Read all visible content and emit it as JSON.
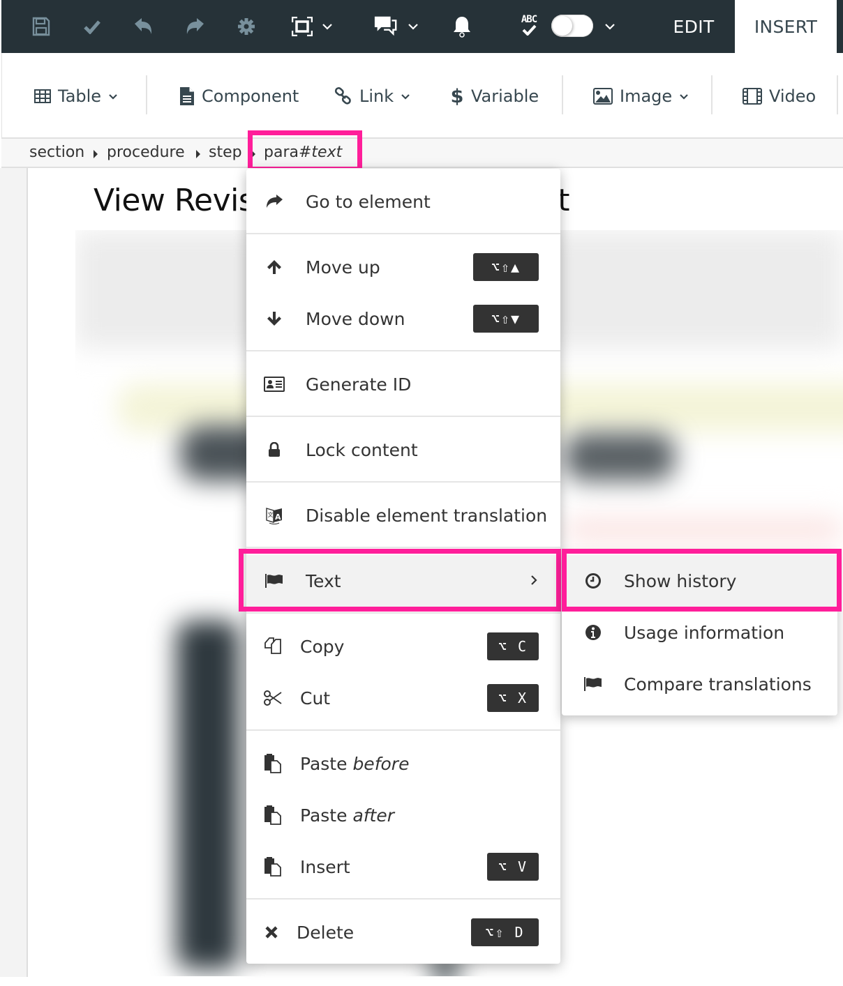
{
  "toolbar": {
    "icons": [
      "save-icon",
      "check-icon",
      "undo-icon",
      "redo-icon",
      "settings-icon",
      "fullscreen-icon",
      "comments-icon",
      "notifications-icon",
      "spellcheck-icon"
    ],
    "spellcheck_label": "ABC",
    "spellcheck_enabled": false,
    "modes": [
      {
        "label": "EDIT",
        "active": false
      },
      {
        "label": "INSERT",
        "active": true
      }
    ]
  },
  "ribbon": {
    "items": [
      {
        "label": "Table",
        "icon": "table-icon",
        "dropdown": true
      },
      {
        "label": "Component",
        "icon": "file-icon",
        "dropdown": false
      },
      {
        "label": "Link",
        "icon": "link-icon",
        "dropdown": true
      },
      {
        "label": "Variable",
        "icon": "dollar-icon",
        "dropdown": false
      },
      {
        "label": "Image",
        "icon": "image-icon",
        "dropdown": true
      },
      {
        "label": "Video",
        "icon": "film-icon",
        "dropdown": false
      }
    ]
  },
  "breadcrumb": {
    "items": [
      "section",
      "procedure",
      "step"
    ],
    "selected": {
      "element": "para",
      "separator": "#",
      "type": "text"
    }
  },
  "document": {
    "title_visible_start": "View Revis",
    "title_visible_end": "ent"
  },
  "context_menu": {
    "items": [
      {
        "label": "Go to element",
        "icon": "share-arrow-icon",
        "shortcut": null
      },
      {
        "label": "Move up",
        "icon": "arrow-up-icon",
        "shortcut": "⌥⇧▲"
      },
      {
        "label": "Move down",
        "icon": "arrow-down-icon",
        "shortcut": "⌥⇧▼"
      },
      {
        "label": "Generate ID",
        "icon": "id-card-icon",
        "shortcut": null
      },
      {
        "label": "Lock content",
        "icon": "lock-icon",
        "shortcut": null
      },
      {
        "label": "Disable element translation",
        "icon": "translate-icon",
        "shortcut": null
      },
      {
        "label": "Text",
        "icon": "flag-icon",
        "shortcut": null,
        "submenu": true,
        "active": true
      },
      {
        "label": "Copy",
        "icon": "copy-icon",
        "shortcut": "⌥ C"
      },
      {
        "label": "Cut",
        "icon": "scissors-icon",
        "shortcut": "⌥ X"
      },
      {
        "label": "Paste",
        "label_em": "before",
        "icon": "paste-icon",
        "shortcut": null
      },
      {
        "label": "Paste",
        "label_em": "after",
        "icon": "paste-icon",
        "shortcut": null
      },
      {
        "label": "Insert",
        "icon": "paste-icon",
        "shortcut": "⌥ V"
      },
      {
        "label": "Delete",
        "icon": "close-icon",
        "shortcut": "⌥⇧ D"
      }
    ]
  },
  "submenu": {
    "items": [
      {
        "label": "Show history",
        "icon": "clock-icon",
        "active": true
      },
      {
        "label": "Usage information",
        "icon": "info-icon",
        "active": false
      },
      {
        "label": "Compare translations",
        "icon": "flag-icon",
        "active": false
      }
    ]
  },
  "colors": {
    "toolbar_bg": "#263238",
    "toolbar_icon_muted": "#78909c",
    "annotation_highlight": "#ff1e9a",
    "shortcut_bg": "#333333",
    "menu_active_bg": "#f2f2f2"
  }
}
